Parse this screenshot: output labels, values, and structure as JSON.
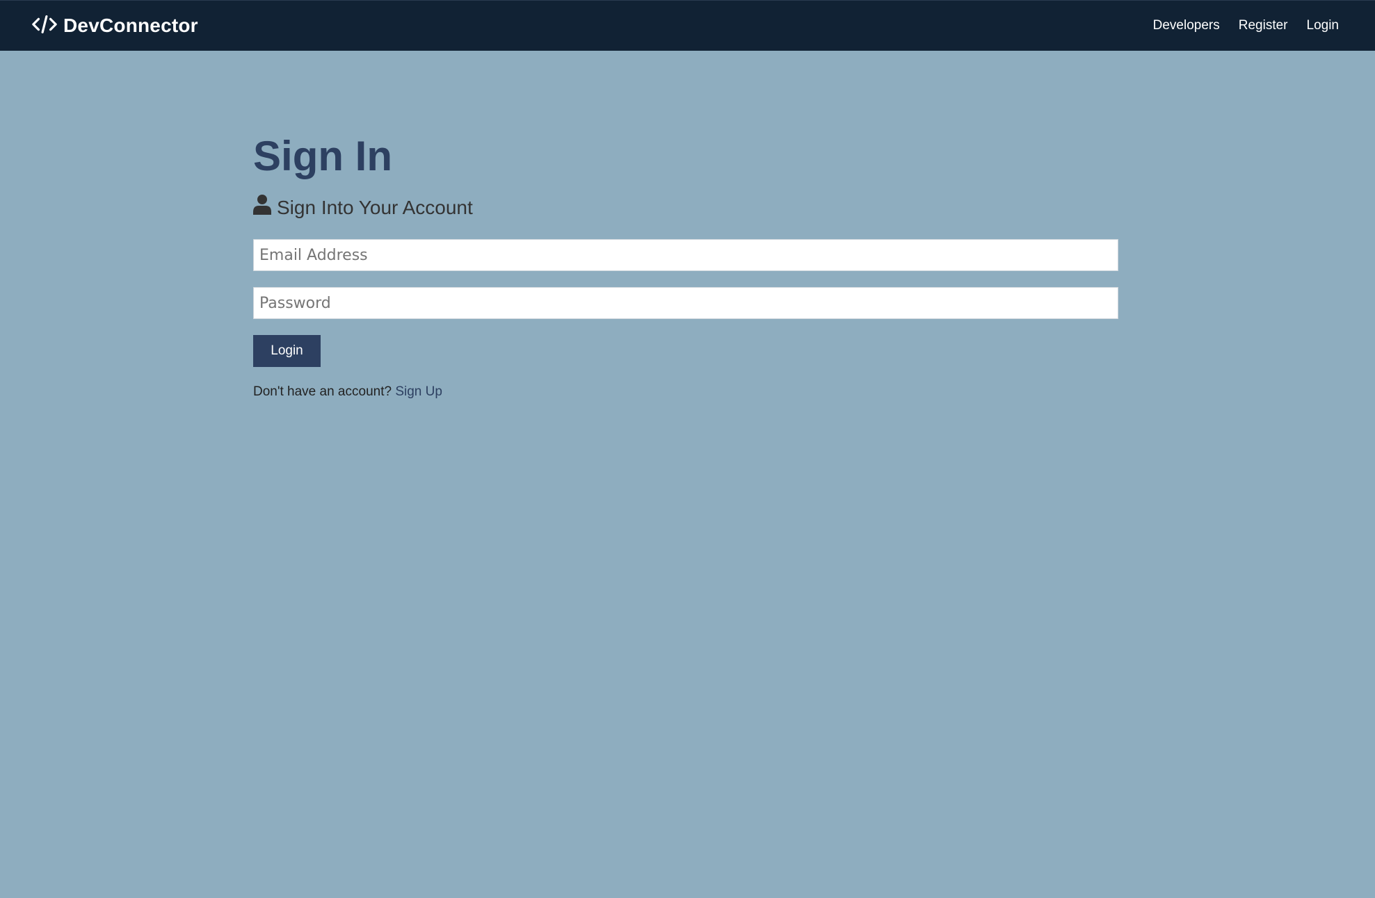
{
  "navbar": {
    "brand_icon": "code-icon",
    "brand": "DevConnector",
    "links": [
      {
        "label": "Developers"
      },
      {
        "label": "Register"
      },
      {
        "label": "Login"
      }
    ]
  },
  "main": {
    "title": "Sign In",
    "lead_icon": "user-icon",
    "lead": "Sign Into Your Account",
    "email_placeholder": "Email Address",
    "email_value": "",
    "password_placeholder": "Password",
    "password_value": "",
    "submit_label": "Login",
    "footer_text": "Don't have an account?",
    "signup_label": "Sign Up"
  },
  "colors": {
    "navbar_bg": "#112234",
    "page_bg": "#8eadbf",
    "primary": "#2d4061"
  }
}
